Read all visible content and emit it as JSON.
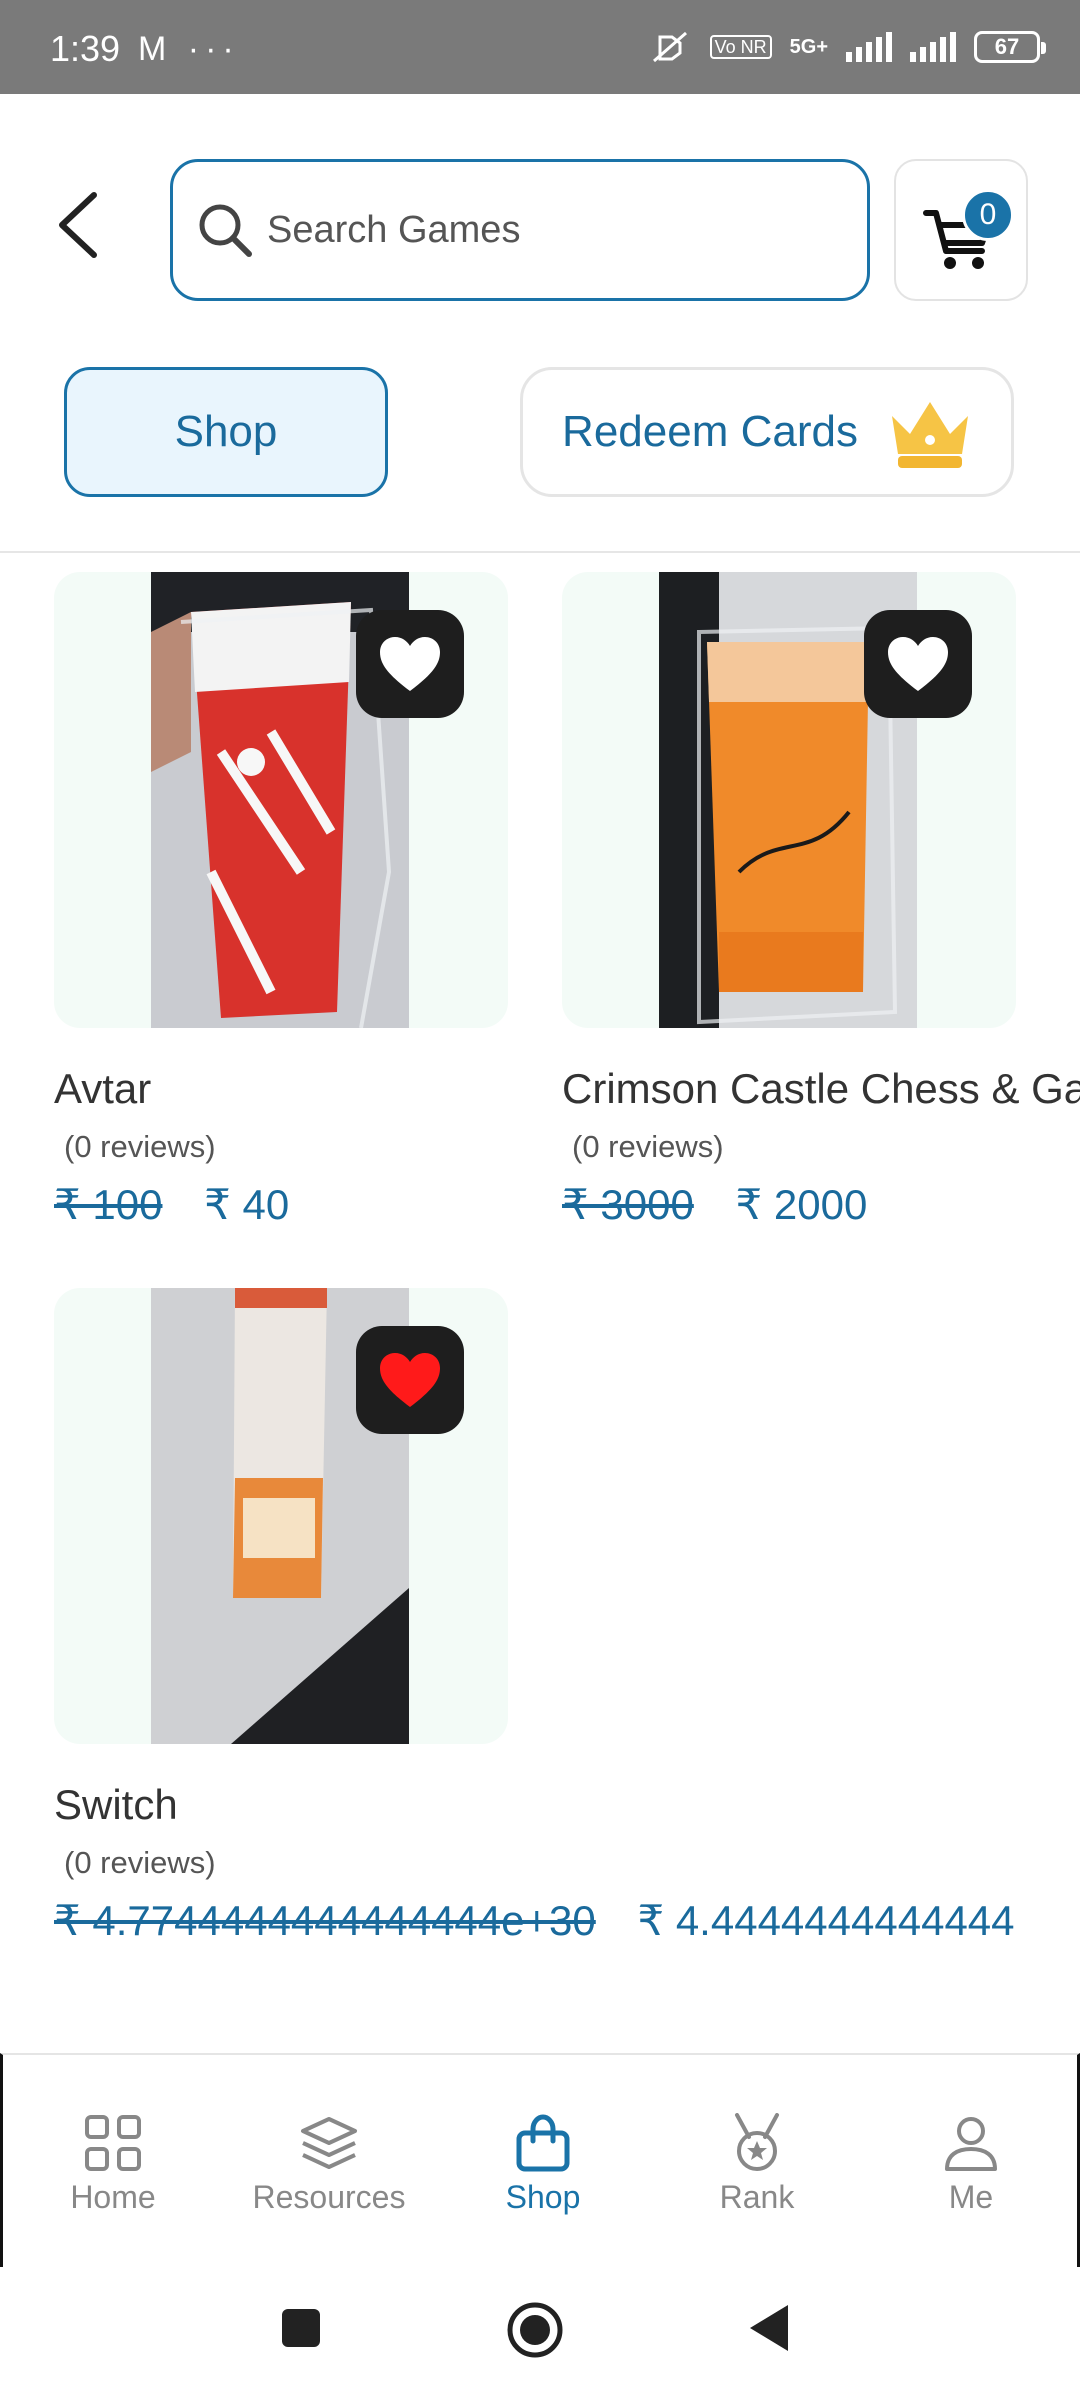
{
  "status_bar": {
    "time": "1:39",
    "left_icons": "M ···",
    "network": "5G+",
    "volte": "Vo NR",
    "battery": "67"
  },
  "header": {
    "search_placeholder": "Search Games",
    "cart_count": "0"
  },
  "tabs": {
    "shop": "Shop",
    "redeem": "Redeem Cards"
  },
  "products": [
    {
      "name": "Avtar",
      "reviews": "(0 reviews)",
      "old_price": "₹ 100",
      "price": "₹ 40",
      "favorited": false
    },
    {
      "name": "Crimson Castle Chess & Gar",
      "reviews": "(0 reviews)",
      "old_price": "₹ 3000",
      "price": "₹ 2000",
      "favorited": false
    },
    {
      "name": "Switch",
      "reviews": "(0 reviews)",
      "old_price": "₹ 4.7744444444444444e+30",
      "price": "₹ 4.4444444444444",
      "favorited": true
    }
  ],
  "bottom_nav": {
    "items": [
      {
        "label": "Home",
        "icon": "grid-icon"
      },
      {
        "label": "Resources",
        "icon": "layers-icon"
      },
      {
        "label": "Shop",
        "icon": "shopping-bag-icon",
        "active": true
      },
      {
        "label": "Rank",
        "icon": "medal-icon"
      },
      {
        "label": "Me",
        "icon": "user-icon"
      }
    ]
  },
  "colors": {
    "accent": "#1a73a8",
    "favorite_active": "#ff1a1a",
    "card_bg": "#f3fbf7"
  }
}
